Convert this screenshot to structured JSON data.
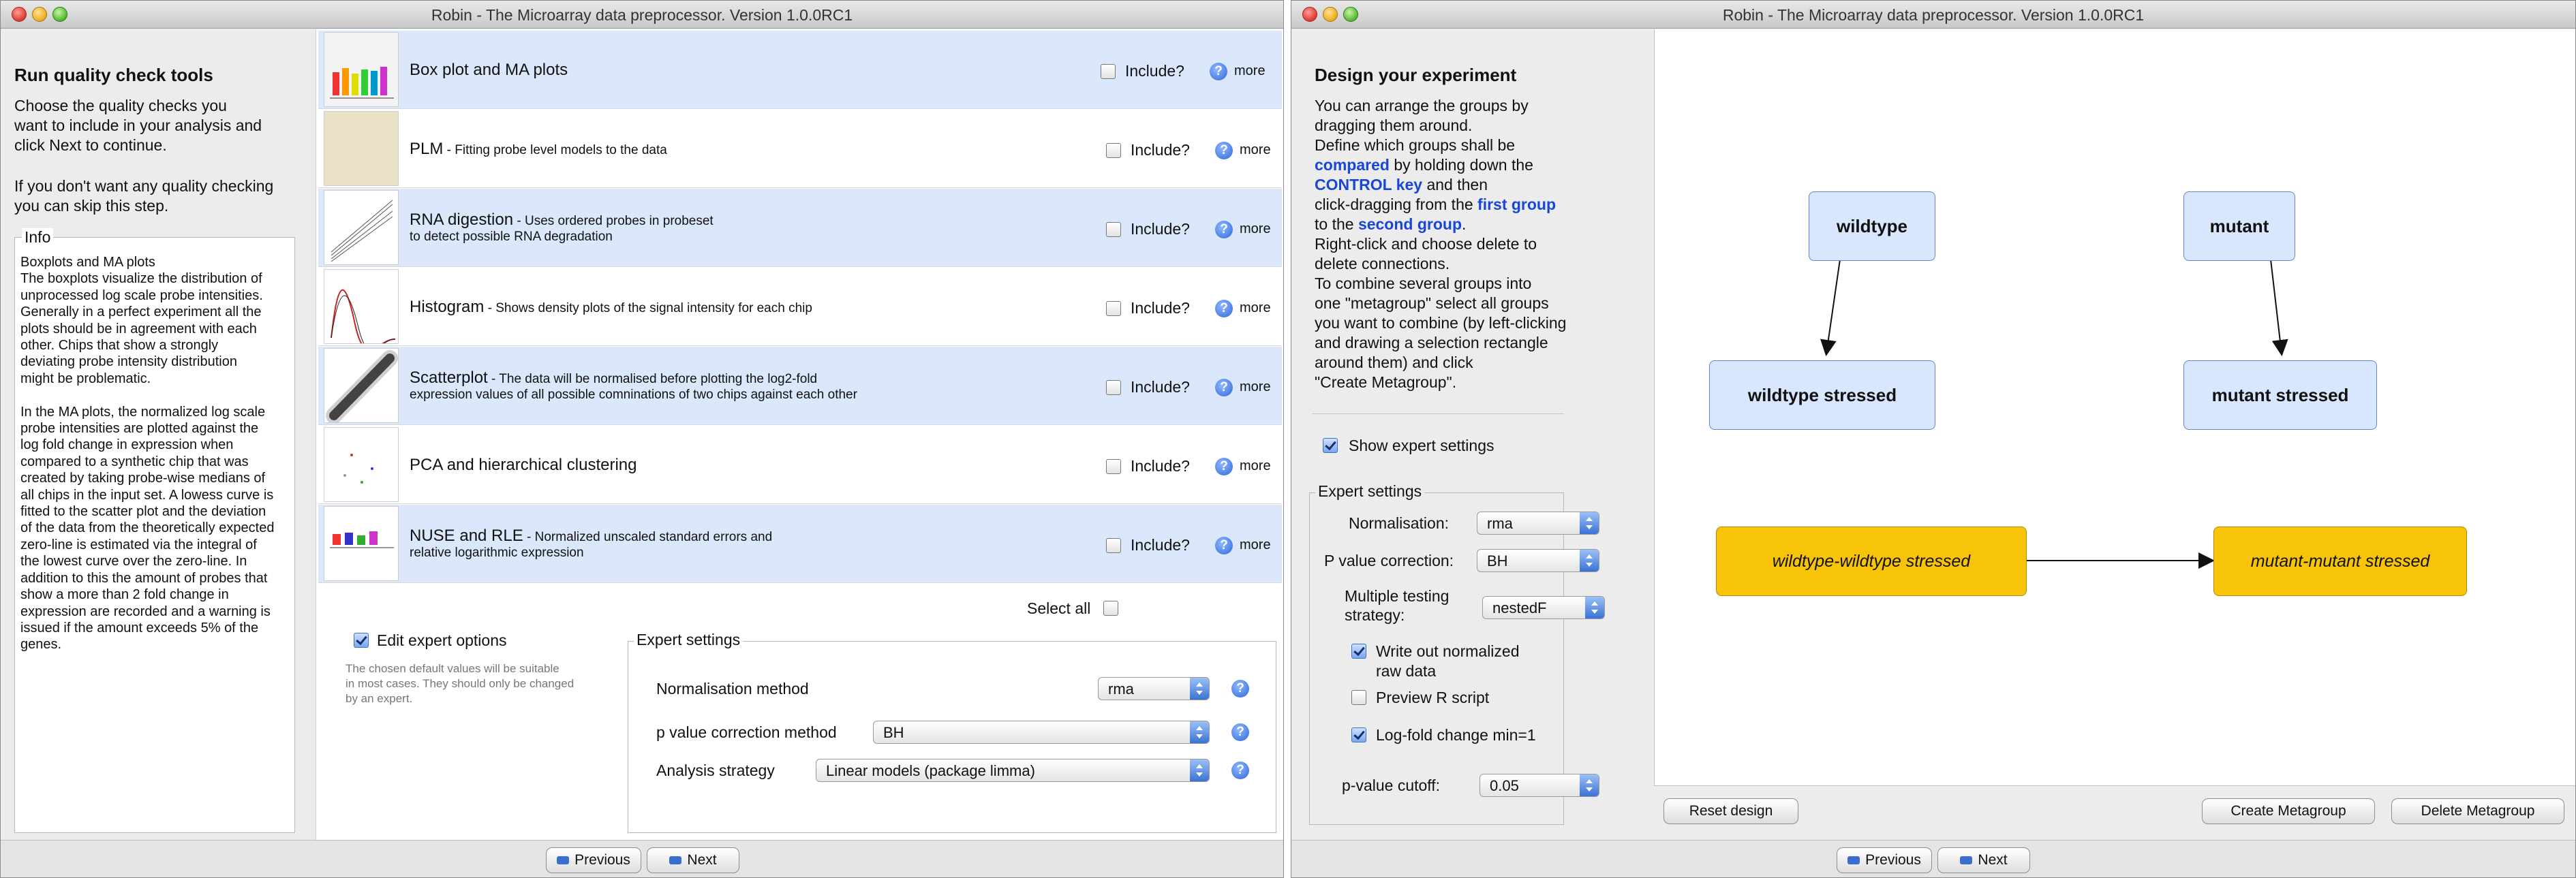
{
  "app_title": "Robin - The Microarray data preprocessor. Version 1.0.0RC1",
  "left": {
    "heading": "Run quality check tools",
    "intro": [
      "Choose the quality checks you",
      "want to include in your analysis and",
      "click Next to continue."
    ],
    "skip": [
      "If you don't want any quality checking",
      "you can skip this step."
    ],
    "info_label": "Info",
    "info_lines": [
      "Boxplots and MA plots",
      "The boxplots visualize the distribution of",
      "unprocessed log scale probe intensities.",
      "Generally in a perfect experiment all the",
      "plots should be in agreement with each",
      "other. Chips that show a strongly",
      "deviating probe intensity distribution",
      "might be problematic.",
      "",
      "In the MA plots, the normalized log scale",
      "probe intensities are plotted against the",
      "log fold change in expression when",
      "compared to a synthetic chip that was",
      "created by taking probe-wise medians of",
      "all chips in the input set. A lowess curve is",
      "fitted to the scatter plot and the deviation",
      "of the data from the theoretically expected",
      "zero-line is estimated via the integral of",
      "the lowest curve over the zero-line. In",
      "addition to this the amount of probes that",
      "show a more than 2 fold change in",
      "expression are recorded and a warning is",
      "issued if the amount exceeds 5% of the",
      "genes."
    ],
    "checks": [
      {
        "title": "Box plot and MA plots",
        "sub": "",
        "sub2": "",
        "include": "Include?",
        "more": "more",
        "checked": false
      },
      {
        "title": "PLM",
        "sub": " - Fitting probe level models to the data",
        "sub2": "",
        "include": "Include?",
        "more": "more",
        "checked": false
      },
      {
        "title": "RNA digestion",
        "sub": " - Uses ordered probes in probeset",
        "sub2": "to detect possible RNA degradation",
        "include": "Include?",
        "more": "more",
        "checked": false
      },
      {
        "title": "Histogram",
        "sub": " - Shows density plots of the signal intensity for each chip",
        "sub2": "",
        "include": "Include?",
        "more": "more",
        "checked": false
      },
      {
        "title": "Scatterplot",
        "sub": " - The data will be normalised before plotting the log2-fold",
        "sub2": "expression values of all possible comninations of two chips against each other",
        "include": "Include?",
        "more": "more",
        "checked": false
      },
      {
        "title": "PCA and hierarchical clustering",
        "sub": "",
        "sub2": "",
        "include": "Include?",
        "more": "more",
        "checked": false
      },
      {
        "title": "NUSE and RLE",
        "sub": " - Normalized unscaled standard errors and",
        "sub2": "relative logarithmic expression",
        "include": "Include?",
        "more": "more",
        "checked": false
      }
    ],
    "select_all": "Select all",
    "edit_expert": "Edit expert options",
    "edit_expert_note": [
      "The chosen default values will be suitable",
      "in most cases. They should only be changed",
      "by an expert."
    ],
    "expert_settings_label": "Expert settings",
    "normalisation_label": "Normalisation method",
    "normalisation_value": "rma",
    "pvalue_label": "p value correction method",
    "pvalue_value": "BH",
    "strategy_label": "Analysis strategy",
    "strategy_value": "Linear models (package limma)",
    "previous": "Previous",
    "next": "Next"
  },
  "right": {
    "heading": "Design your experiment",
    "desc_lines": [
      "You can arrange the groups by",
      "dragging them around.",
      "Define which groups shall be",
      [
        "",
        "compared",
        " by holding down the"
      ],
      [
        "",
        "CONTROL key",
        " and then"
      ],
      [
        "click-dragging from the ",
        "first group",
        ""
      ],
      [
        "to the ",
        "second group",
        "."
      ],
      "Right-click and choose delete to",
      "delete connections.",
      "To combine several groups into",
      "one \"metagroup\" select all groups",
      "you want to combine (by left-clicking",
      "and drawing a selection rectangle",
      "around them) and click",
      "\"Create Metagroup\"."
    ],
    "show_expert": "Show expert settings",
    "expert_settings_label": "Expert settings",
    "normalisation_label": "Normalisation:",
    "normalisation_value": "rma",
    "pvalue_corr_label": "P value correction:",
    "pvalue_corr_value": "BH",
    "mt_label_1": "Multiple testing",
    "mt_label_2": "strategy:",
    "mt_value": "nestedF",
    "write_out_1": "Write out normalized",
    "write_out_2": "raw data",
    "preview_r": "Preview R script",
    "logfold": "Log-fold change min=1",
    "pcutoff_label": "p-value cutoff:",
    "pcutoff_value": "0.05",
    "nodes": {
      "wildtype": "wildtype",
      "mutant": "mutant",
      "wildtype_stressed": "wildtype stressed",
      "mutant_stressed": "mutant stressed",
      "meta_wt": "wildtype-wildtype stressed",
      "meta_mut": "mutant-mutant stressed"
    },
    "reset": "Reset design",
    "create_meta": "Create Metagroup",
    "delete_meta": "Delete Metagroup",
    "previous": "Previous",
    "next": "Next"
  }
}
